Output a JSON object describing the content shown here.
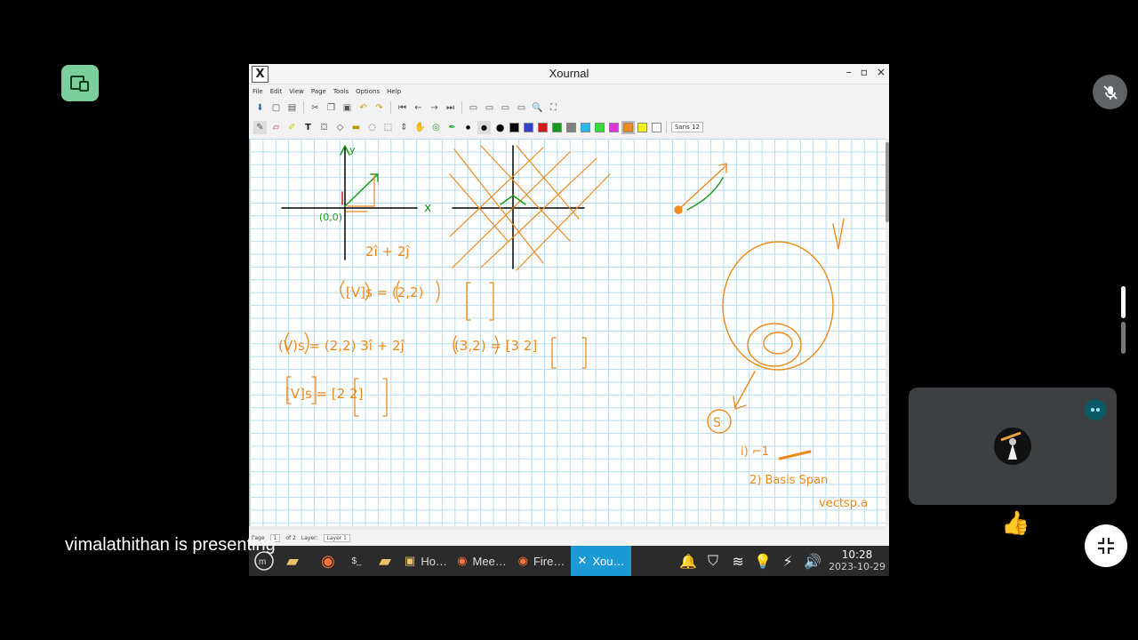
{
  "meet": {
    "presenting_text": "vimalathithan is presenting",
    "accent_green": "#7bcf9b",
    "thumbs_up": "👍"
  },
  "app": {
    "title": "Xournal",
    "logo": "X",
    "window_controls": [
      "–",
      "▫",
      "×"
    ],
    "menu": [
      "File",
      "Edit",
      "View",
      "Page",
      "Tools",
      "Options",
      "Help"
    ],
    "font_name": "Sans",
    "font_size": "12",
    "pen_colors": [
      "#000000",
      "#3344cc",
      "#d11a1a",
      "#1a9a1a",
      "#7f7f7f",
      "#29b6e8",
      "#33dd33",
      "#dd33dd",
      "#ee8a1a",
      "#f2f21a",
      "#ffffff"
    ],
    "selected_color": "#ee8a1a"
  },
  "statusbar": {
    "page_label": "Page",
    "page_value": "1",
    "of_label": "of 2",
    "layer_label": "Layer:",
    "layer_value": "Layer 1"
  },
  "taskbar": {
    "items": [
      "Ho…",
      "Mee…",
      "Fire…",
      "Xou…"
    ],
    "time": "10:28",
    "date": "2023-10-29"
  },
  "ink": {
    "axis_x": "x",
    "axis_y": "y",
    "origin": "(0,0)",
    "expr1": "2î + 2ĵ",
    "expr2": "[V]s = (2,2)",
    "expr3": "(V)s = (2,2) 3î + 2ĵ",
    "expr4": "(3,2) = [3 2]",
    "expr5": "[V]s = [2 2]",
    "note_s": "S",
    "note_1": "i) ⌐1",
    "note_2": "2) Basis Span",
    "note_3": "vectsp.a"
  }
}
